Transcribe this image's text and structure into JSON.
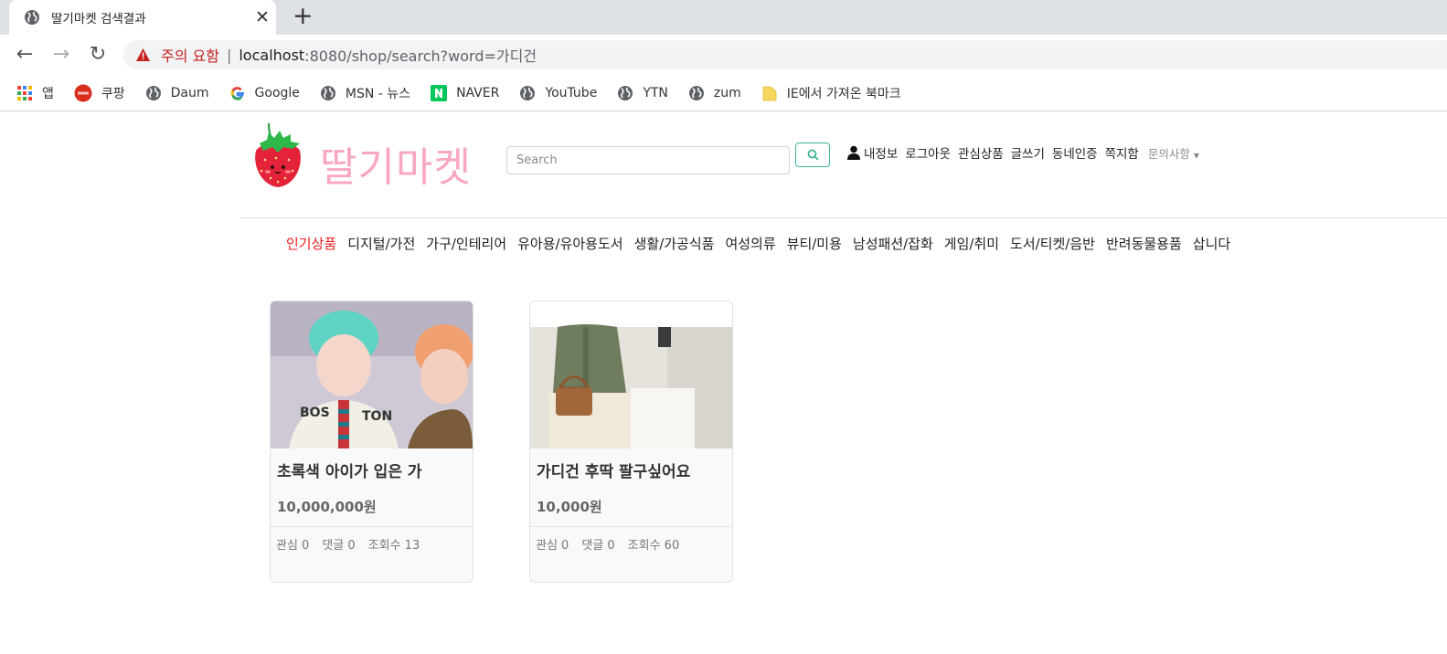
{
  "browser": {
    "tab_title": "딸기마켓 검색결과",
    "url_warning": "주의 요함",
    "url_host": "localhost",
    "url_rest": ":8080/shop/search?word=가디건",
    "bookmarks": [
      {
        "label": "앱",
        "icon": "apps-grid-icon"
      },
      {
        "label": "쿠팡",
        "icon": "coupang-icon"
      },
      {
        "label": "Daum",
        "icon": "globe-icon"
      },
      {
        "label": "Google",
        "icon": "google-icon"
      },
      {
        "label": "MSN - 뉴스",
        "icon": "globe-icon"
      },
      {
        "label": "NAVER",
        "icon": "naver-icon"
      },
      {
        "label": "YouTube",
        "icon": "globe-icon"
      },
      {
        "label": "YTN",
        "icon": "globe-icon"
      },
      {
        "label": "zum",
        "icon": "globe-icon"
      },
      {
        "label": "IE에서 가져온 북마크",
        "icon": "folder-icon"
      }
    ]
  },
  "header": {
    "brand": "딸기마켓",
    "search_placeholder": "Search",
    "menu": {
      "my_info": "내정보",
      "logout": "로그아웃",
      "wishlist": "관심상품",
      "write": "글쓰기",
      "neighborhood_auth": "동네인증",
      "messages": "쪽지함",
      "inquiry": "문의사항"
    }
  },
  "categories": [
    {
      "label": "인기상품",
      "active": true
    },
    {
      "label": "디지털/가전",
      "active": false
    },
    {
      "label": "가구/인테리어",
      "active": false
    },
    {
      "label": "유아용/유아용도서",
      "active": false
    },
    {
      "label": "생활/가공식품",
      "active": false
    },
    {
      "label": "여성의류",
      "active": false
    },
    {
      "label": "뷰티/미용",
      "active": false
    },
    {
      "label": "남성패션/잡화",
      "active": false
    },
    {
      "label": "게임/취미",
      "active": false
    },
    {
      "label": "도서/티켓/음반",
      "active": false
    },
    {
      "label": "반려동물용품",
      "active": false
    },
    {
      "label": "삽니다",
      "active": false
    }
  ],
  "products": [
    {
      "title": "초록색 아이가 입은 가",
      "price": "10,000,000원",
      "interest": "관심 0",
      "comments": "댓글 0",
      "views": "조회수 13"
    },
    {
      "title": "가디건 후딱 팔구싶어요",
      "price": "10,000원",
      "interest": "관심 0",
      "comments": "댓글 0",
      "views": "조회수 60"
    }
  ],
  "colors": {
    "brand_pink": "#f8a8be",
    "active_category": "#f11c1c",
    "search_button": "#3cb497",
    "warning_red": "#c5221f"
  }
}
